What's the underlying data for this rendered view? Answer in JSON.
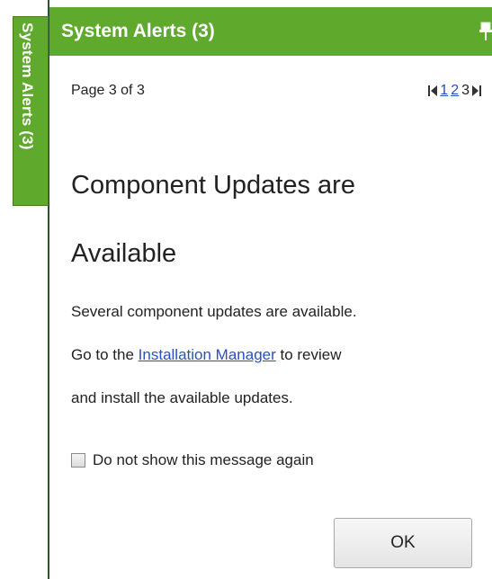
{
  "side_tab": {
    "label": "System Alerts (3)"
  },
  "header": {
    "title": "System Alerts (3)",
    "pin_icon": "pin-icon"
  },
  "content": {
    "page_info": "Page 3 of 3",
    "pager": {
      "first_icon": "first-page-icon",
      "pages": [
        "1",
        "2",
        "3"
      ],
      "current_page": "3",
      "last_icon": "last-page-icon"
    },
    "heading_line1": "Component Updates are",
    "heading_line2": "Available",
    "body_line1": "Several component updates are available.",
    "body_line2_prefix": "Go to the ",
    "body_link": "Installation Manager",
    "body_line2_suffix": " to review",
    "body_line3": "and install the available updates.",
    "checkbox_label": "Do not show this message again",
    "checkbox_checked": false,
    "ok_label": "OK"
  },
  "colors": {
    "accent_green": "#5fa92d",
    "link_blue": "#2a4fbf"
  }
}
